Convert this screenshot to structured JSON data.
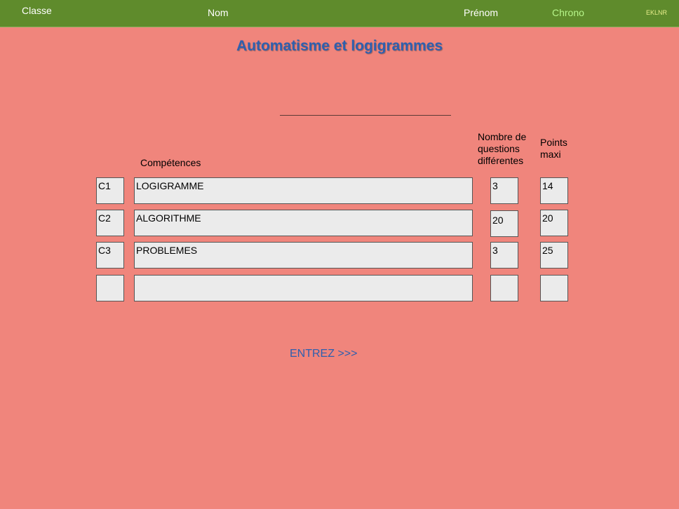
{
  "topbar": {
    "classe": "Classe",
    "nom": "Nom",
    "prenom": "Prénom",
    "chrono": "Chrono",
    "code": "EKLNR"
  },
  "title": "Automatisme et logigrammes",
  "headers": {
    "competences": "Compétences",
    "nombre_questions": "Nombre de questions différentes",
    "points_maxi": "Points maxi"
  },
  "rows": [
    {
      "code": "C1",
      "label": "LOGIGRAMME",
      "questions": "3",
      "points": "14"
    },
    {
      "code": "C2",
      "label": "ALGORITHME",
      "questions": "20",
      "points": "20"
    },
    {
      "code": "C3",
      "label": "PROBLEMES",
      "questions": "3",
      "points": "25"
    },
    {
      "code": "",
      "label": "",
      "questions": "",
      "points": ""
    }
  ],
  "enter_label": "ENTREZ >>>"
}
